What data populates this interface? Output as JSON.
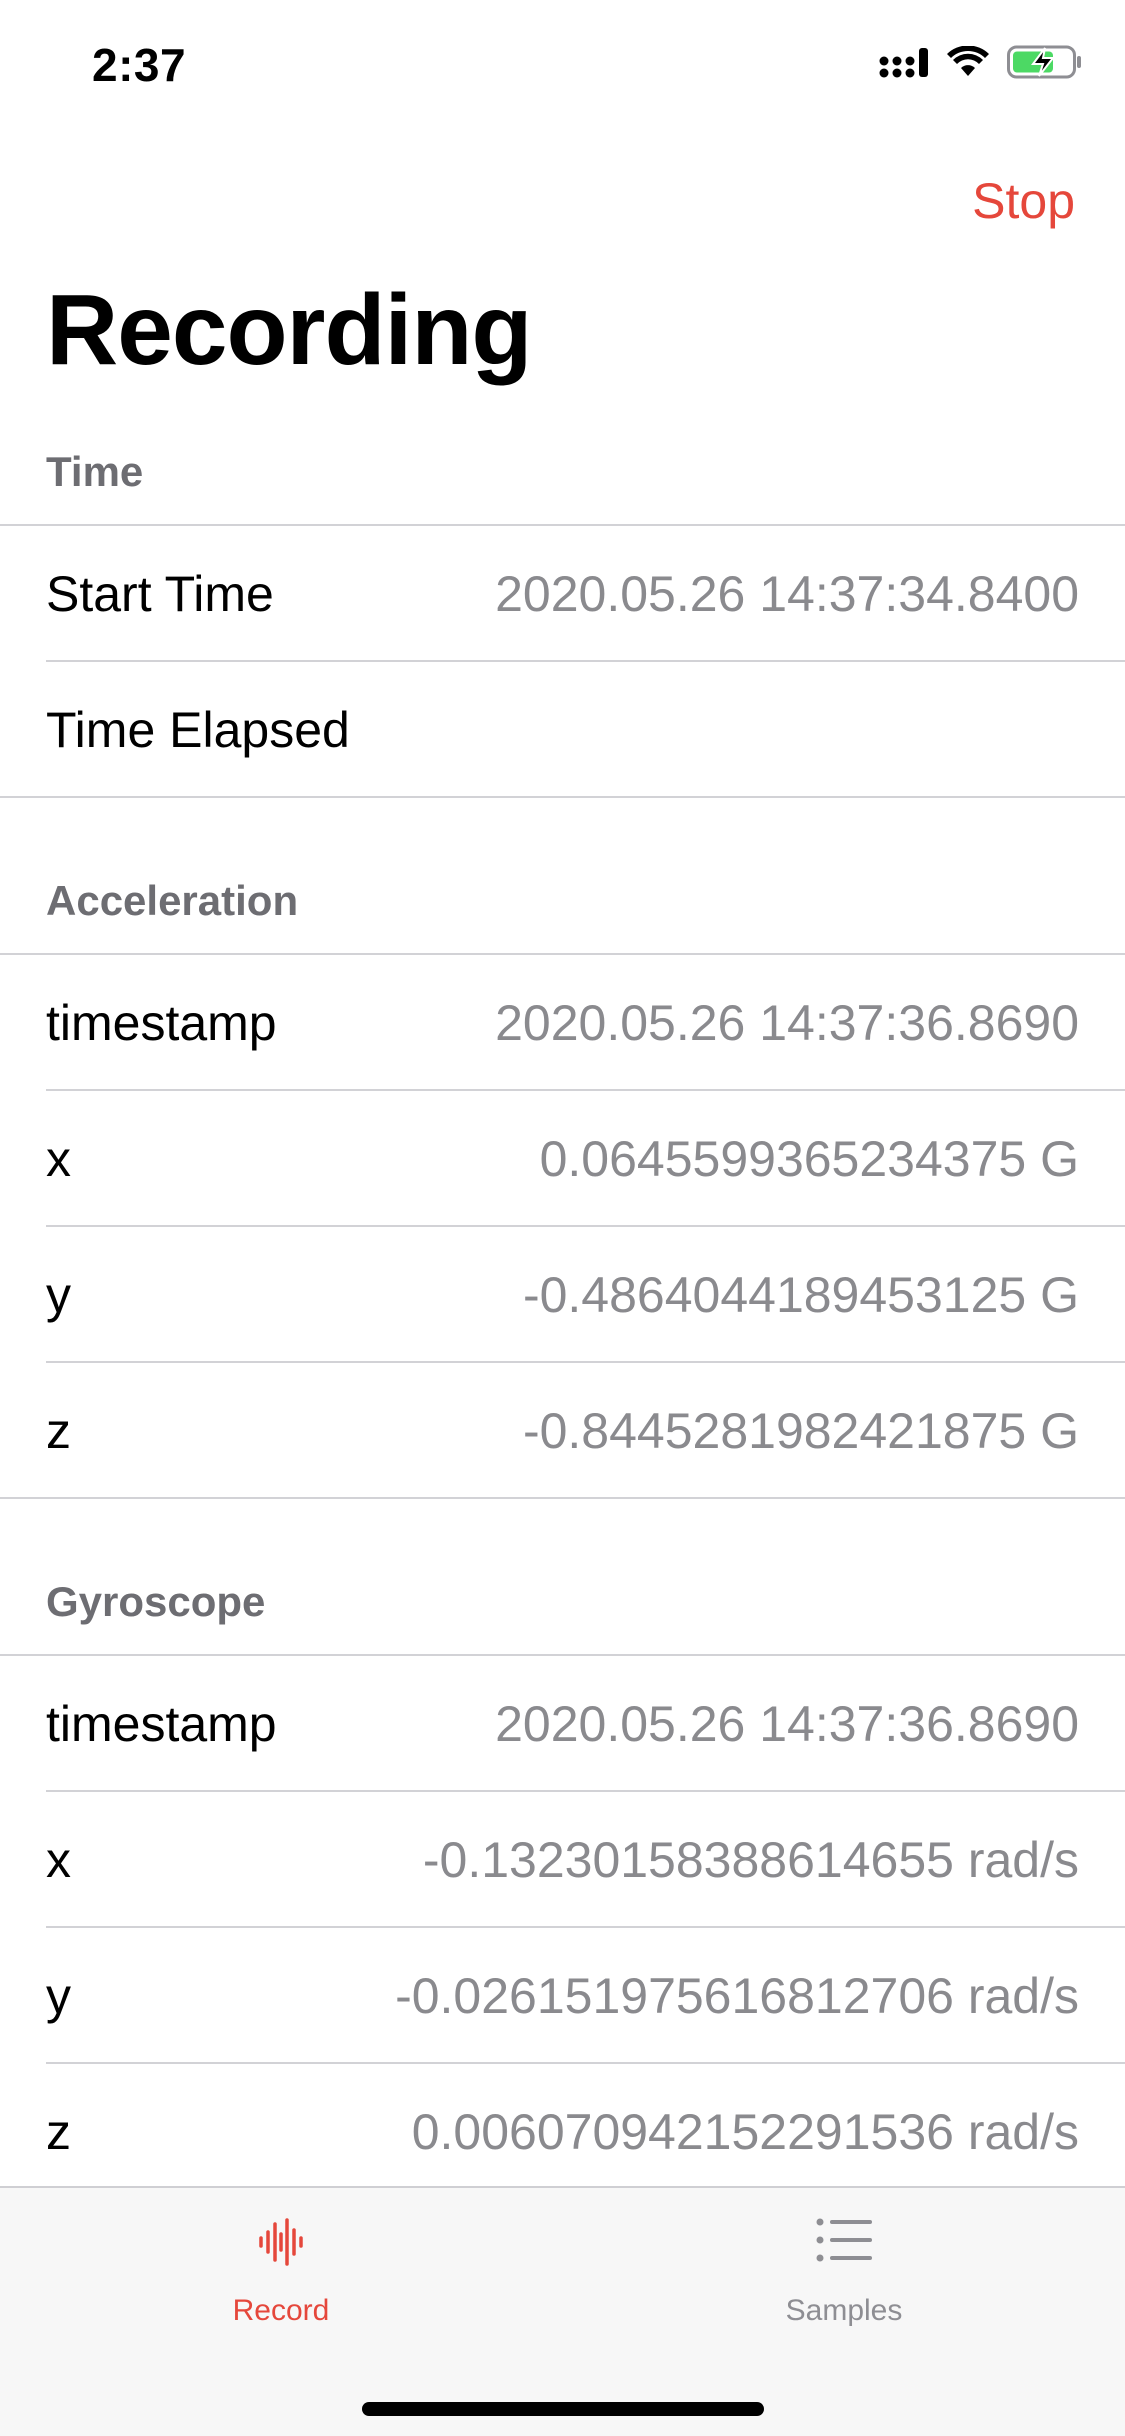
{
  "status_bar": {
    "time": "2:37"
  },
  "nav": {
    "stop_label": "Stop",
    "title": "Recording"
  },
  "sections": {
    "time": {
      "header": "Time",
      "rows": [
        {
          "label": "Start Time",
          "value": "2020.05.26 14:37:34.8400"
        },
        {
          "label": "Time Elapsed",
          "value": ""
        }
      ]
    },
    "acceleration": {
      "header": "Acceleration",
      "rows": [
        {
          "label": "timestamp",
          "value": "2020.05.26 14:37:36.8690"
        },
        {
          "label": "x",
          "value": "0.0645599365234375 G"
        },
        {
          "label": "y",
          "value": "-0.4864044189453125 G"
        },
        {
          "label": "z",
          "value": "-0.8445281982421875 G"
        }
      ]
    },
    "gyroscope": {
      "header": "Gyroscope",
      "rows": [
        {
          "label": "timestamp",
          "value": "2020.05.26 14:37:36.8690"
        },
        {
          "label": "x",
          "value": "-0.13230158388614655 rad/s"
        },
        {
          "label": "y",
          "value": "-0.026151975616812706 rad/s"
        },
        {
          "label": "z",
          "value": "0.006070942152291536 rad/s"
        }
      ]
    }
  },
  "tab_bar": {
    "tabs": [
      {
        "label": "Record",
        "icon": "waveform-icon",
        "active": true
      },
      {
        "label": "Samples",
        "icon": "list-icon",
        "active": false
      }
    ]
  },
  "colors": {
    "accent": "#e5473b",
    "secondary_text": "#8a8a8e",
    "section_header": "#6d6d72",
    "separator": "#d2d2d6",
    "tab_bar_bg": "#f7f7f7"
  }
}
